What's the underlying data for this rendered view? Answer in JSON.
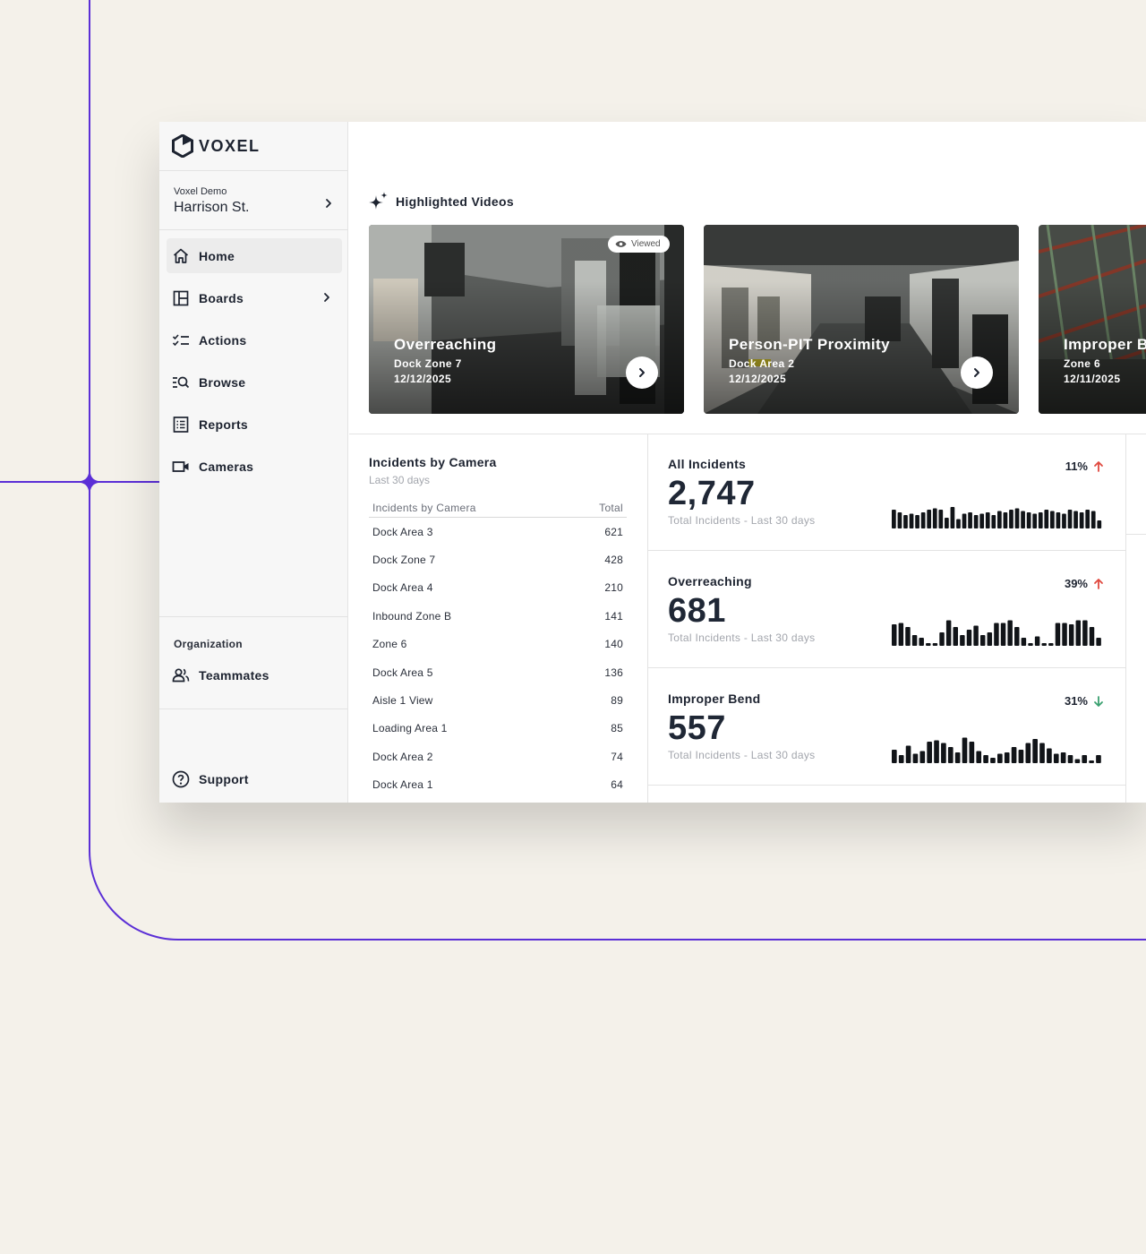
{
  "brand": {
    "name": "VOXEL"
  },
  "site": {
    "org": "Voxel Demo",
    "name": "Harrison St."
  },
  "nav": [
    {
      "label": "Home",
      "icon": "home-icon",
      "active": true
    },
    {
      "label": "Boards",
      "icon": "boards-icon",
      "has_chevron": true
    },
    {
      "label": "Actions",
      "icon": "checklist-icon"
    },
    {
      "label": "Browse",
      "icon": "browse-search-icon"
    },
    {
      "label": "Reports",
      "icon": "reports-icon"
    },
    {
      "label": "Cameras",
      "icon": "camera-icon"
    }
  ],
  "organization": {
    "title": "Organization",
    "teammates_label": "Teammates"
  },
  "support_label": "Support",
  "highlighted": {
    "title": "Highlighted Videos",
    "videos": [
      {
        "title": "Overreaching",
        "location": "Dock Zone 7",
        "date": "12/12/2025",
        "badge": "Viewed"
      },
      {
        "title": "Person-PIT Proximity",
        "location": "Dock Area 2",
        "date": "12/12/2025"
      },
      {
        "title": "Improper B",
        "location": "Zone 6",
        "date": "12/11/2025"
      }
    ]
  },
  "incidents_by_camera": {
    "title": "Incidents by Camera",
    "subtitle": "Last 30 days",
    "col_camera": "Incidents by Camera",
    "col_total": "Total",
    "rows": [
      {
        "camera": "Dock Area 3",
        "total": "621"
      },
      {
        "camera": "Dock Zone 7",
        "total": "428"
      },
      {
        "camera": "Dock Area 4",
        "total": "210"
      },
      {
        "camera": "Inbound Zone B",
        "total": "141"
      },
      {
        "camera": "Zone 6",
        "total": "140"
      },
      {
        "camera": "Dock Area 5",
        "total": "136"
      },
      {
        "camera": "Aisle 1 View",
        "total": "89"
      },
      {
        "camera": "Loading Area 1",
        "total": "85"
      },
      {
        "camera": "Dock Area 2",
        "total": "74"
      },
      {
        "camera": "Dock Area 1",
        "total": "64"
      }
    ]
  },
  "stat_cards": [
    {
      "title": "All Incidents",
      "value": "2,747",
      "subtitle": "Total Incidents - Last 30 days",
      "change": "11%",
      "direction": "up",
      "change_color": "#e0493f",
      "spark": [
        0.7,
        0.6,
        0.5,
        0.55,
        0.5,
        0.6,
        0.7,
        0.75,
        0.7,
        0.4,
        0.8,
        0.35,
        0.55,
        0.6,
        0.5,
        0.55,
        0.6,
        0.5,
        0.65,
        0.6,
        0.7,
        0.75,
        0.65,
        0.6,
        0.55,
        0.6,
        0.7,
        0.65,
        0.6,
        0.55,
        0.7,
        0.65,
        0.6,
        0.7,
        0.65,
        0.3
      ]
    },
    {
      "title": "Overreaching",
      "value": "681",
      "subtitle": "Total Incidents - Last 30 days",
      "change": "39%",
      "direction": "up",
      "change_color": "#e0493f",
      "spark": [
        0.8,
        0.85,
        0.7,
        0.4,
        0.3,
        0.1,
        0.1,
        0.5,
        0.95,
        0.7,
        0.4,
        0.6,
        0.75,
        0.4,
        0.5,
        0.85,
        0.85,
        0.95,
        0.7,
        0.3,
        0.1,
        0.35,
        0.1,
        0.1,
        0.85,
        0.85,
        0.8,
        0.95,
        0.95,
        0.7,
        0.3
      ]
    },
    {
      "title": "Improper Bend",
      "value": "557",
      "subtitle": "Total Incidents - Last 30 days",
      "change": "31%",
      "direction": "down",
      "change_color": "#3aa070",
      "spark": [
        0.5,
        0.3,
        0.65,
        0.35,
        0.45,
        0.8,
        0.85,
        0.75,
        0.6,
        0.4,
        0.95,
        0.8,
        0.45,
        0.3,
        0.2,
        0.35,
        0.4,
        0.6,
        0.5,
        0.75,
        0.9,
        0.75,
        0.55,
        0.35,
        0.4,
        0.3,
        0.15,
        0.3,
        0.1,
        0.3
      ]
    }
  ],
  "colors": {
    "accent": "#5b2fd6",
    "background": "#f4f1ea",
    "up": "#e0493f",
    "down": "#3aa070"
  }
}
